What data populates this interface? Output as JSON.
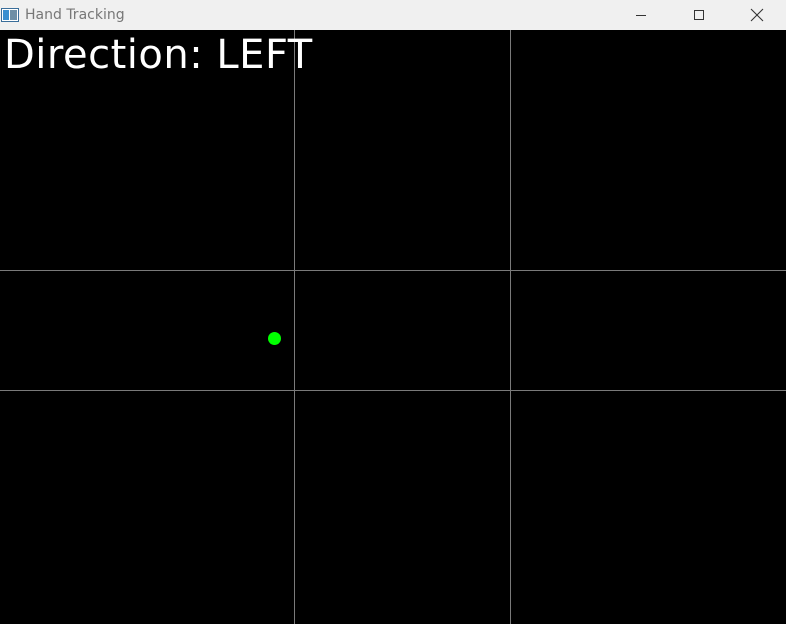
{
  "window": {
    "title": "Hand Tracking",
    "icon": "app-window-icon",
    "controls": [
      {
        "name": "minimize-button",
        "icon": "minimize-icon"
      },
      {
        "name": "maximize-button",
        "icon": "maximize-icon"
      },
      {
        "name": "close-button",
        "icon": "close-icon"
      }
    ]
  },
  "canvas": {
    "direction_text": "Direction: LEFT",
    "background_color": "#000000",
    "grid_color": "#7a7a7a",
    "text_color": "#ffffff",
    "tracking_point_color": "#00ff00"
  }
}
